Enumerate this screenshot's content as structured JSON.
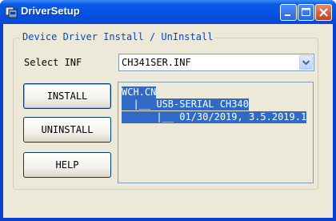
{
  "window": {
    "title": "DriverSetup"
  },
  "group": {
    "legend": "Device Driver Install / UnInstall"
  },
  "inf": {
    "label": "Select INF",
    "selected": "CH341SER.INF"
  },
  "buttons": {
    "install": "INSTALL",
    "uninstall": "UNINSTALL",
    "help": "HELP"
  },
  "info": {
    "lines": [
      "WCH.CN",
      "  |__ USB-SERIAL CH340",
      "      |__ 01/30/2019, 3.5.2019.1"
    ]
  },
  "colors": {
    "title_blue": "#0551e3",
    "selection": "#316ac5",
    "face": "#ece9d8",
    "legend": "#0046d5"
  }
}
